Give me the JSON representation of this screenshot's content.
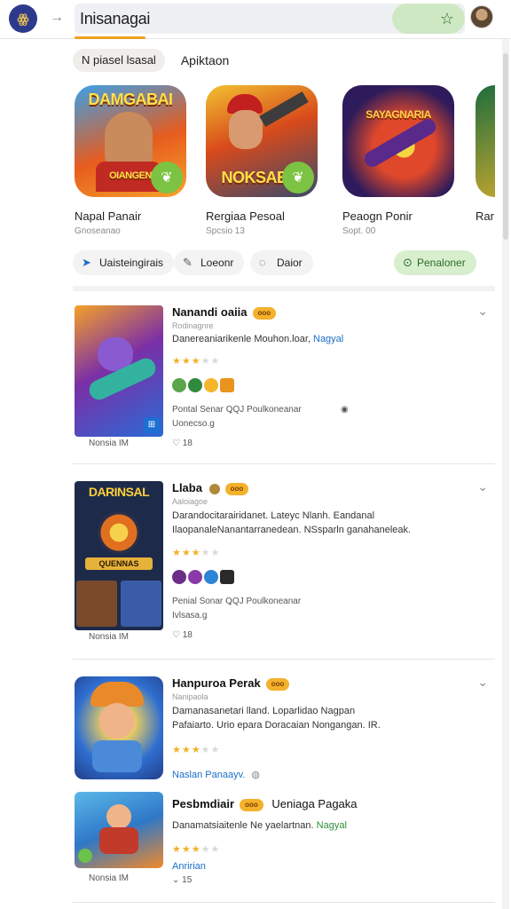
{
  "topbar": {
    "logo_text": "ꙮ",
    "back_icon": "arrow-right-icon",
    "search_query": "Inisanagai",
    "favorite_icon": "star-sparkle-icon"
  },
  "tabs": [
    {
      "label": "N piasel lsasal",
      "active": true
    },
    {
      "label": "Apiktaon",
      "active": false
    }
  ],
  "featured": [
    {
      "title": "Napal Panair",
      "meta": "Gnoseanao",
      "banner": "DAMGABAI",
      "sub_banner": "OIANGEN",
      "colors": [
        "#e65c1e",
        "#f7a32b"
      ]
    },
    {
      "title": "Rergiaa Pesoal",
      "meta": "Spcsio 13",
      "banner": "NOKSAEAI",
      "sub_banner": "",
      "colors": [
        "#3a4a6b",
        "#d84a1b"
      ]
    },
    {
      "title": "Peaogn Ponir",
      "meta": "Sopt. 00",
      "banner": "SAYAGNARIA",
      "sub_banner": "",
      "colors": [
        "#2d1b5b",
        "#e0482b"
      ]
    },
    {
      "title": "Rar",
      "meta": "",
      "banner": "",
      "sub_banner": "",
      "colors": [
        "#1e6d3e",
        "#e3b12c"
      ]
    }
  ],
  "actions": [
    {
      "label": "Uaisteingirais",
      "icon": "navigation-icon"
    },
    {
      "label": "Loeonr",
      "icon": "pencil-icon"
    },
    {
      "label": "Daior",
      "icon": "chat-bubble-icon"
    },
    {
      "label": "Penaloner",
      "icon": "circle-check-icon"
    }
  ],
  "results": [
    {
      "title": "Nanandi oaiia",
      "tag": "ooo",
      "subtitle": "Rodinagnre",
      "desc_lines": [
        {
          "text": "Danereaniarikenle Mouhon.loar,",
          "highlight": "Nagyal"
        }
      ],
      "rating": 3,
      "info": "Pontal   Senar   ꝖQJ   Poulkoneanar",
      "info_tail": "Uonecso.g",
      "thumb_caption": "Nonsia IM",
      "count": "18",
      "thumb_banner": ""
    },
    {
      "title": "Llaba",
      "tag": "ooo",
      "subtitle": "Aaloiagoe",
      "desc_lines": [
        {
          "text": "Darandocitarairidanet. Lateyc Nlanh. Eandanal",
          "highlight": ""
        },
        {
          "text": "IlaopanaleNanantarranedean. NSsparln ganahaneleak.",
          "highlight": ""
        }
      ],
      "rating": 3,
      "info": "Penial   Sonar   ꝖQJ   Poulkoneanar",
      "info_tail": "Ivlsasa.g",
      "thumb_caption": "Nonsia IM",
      "count": "18",
      "thumb_banner": "DARINSAL",
      "thumb_sub": "QUENNAS"
    },
    {
      "title": "Hanpuroa Perak",
      "tag": "ooo",
      "subtitle": "Nanipaola",
      "desc_lines": [
        {
          "text": "Damanasanetari lland. Loparlidao Nagpan",
          "highlight": ""
        },
        {
          "text": "Pafaiarto. Urio epara Doracaian Nongangan. IR.",
          "highlight": ""
        }
      ],
      "rating": 3,
      "link": "Naslan Panaayv.",
      "info_tail": "",
      "thumb_caption": "",
      "count": "",
      "thumb_banner": ""
    },
    {
      "title": "Pesbmdiair",
      "tag": "ooo",
      "title_tail": "Ueniaga Pagaka",
      "subtitle": "",
      "desc_lines": [
        {
          "text": "Danamatsiaitenle Ne yaelartnan.",
          "highlight_green": "Nagyal"
        }
      ],
      "rating": 3,
      "link": "Anririan",
      "info_tail": "",
      "thumb_caption": "Nonsia IM",
      "count": "15",
      "thumb_banner": ""
    }
  ],
  "colors": {
    "accent_orange": "#f0a020",
    "link_blue": "#1a6fc9",
    "green_pill": "#cfe8c4",
    "star": "#f2b227"
  }
}
